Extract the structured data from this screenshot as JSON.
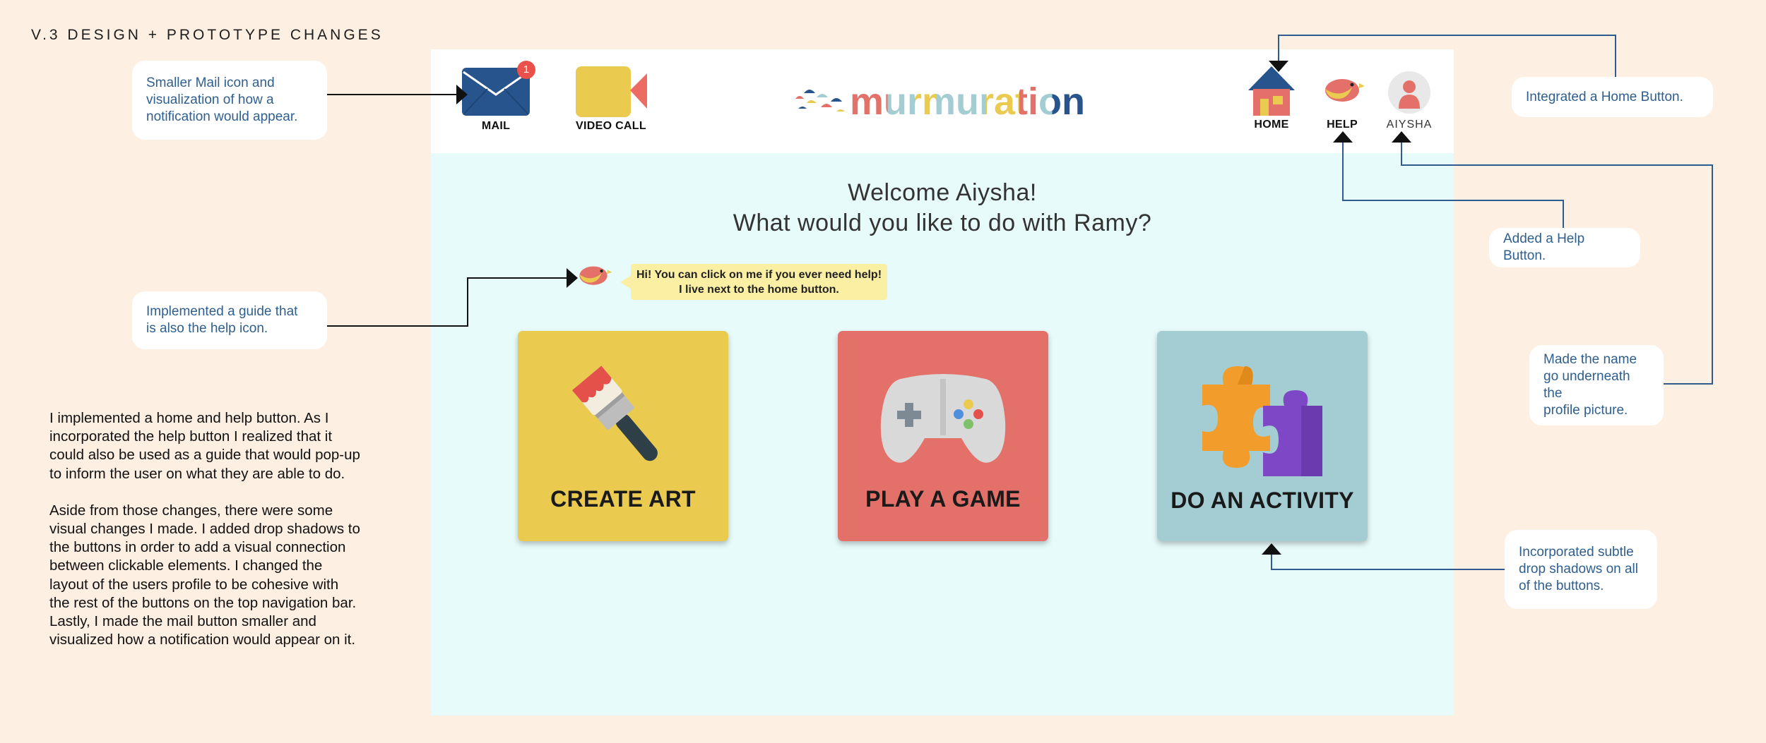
{
  "page_title": "V.3 DESIGN + PROTOTYPE CHANGES",
  "callouts": {
    "mail": "Smaller Mail icon and\nvisualization of how a\nnotification would appear.",
    "guide": "Implemented a guide that\nis also the help icon.",
    "home": "Integrated a Home Button.",
    "help": "Added a Help Button.",
    "name": "Made the name\ngo underneath the\nprofile picture.",
    "shadows": "Incorporated subtle\ndrop shadows on all\nof the buttons."
  },
  "summary": {
    "p1": "I implemented a home and help button. As I incorporated the help button I realized that it could also be used as a guide that would pop-up to inform the user on what they are able to do.",
    "p2": "Aside from those changes, there were some visual changes I made. I added drop shadows to the buttons in order to add a visual connection between clickable elements. I changed the layout of the users profile to be cohesive with the rest of the buttons on the top navigation bar. Lastly, I made the mail button smaller and visualized how a notification would appear on it."
  },
  "app": {
    "logo": "murmuration",
    "nav": {
      "mail": "MAIL",
      "mail_badge": "1",
      "video_call": "VIDEO CALL",
      "home": "HOME",
      "help": "HELP",
      "profile": "AIYSHA"
    },
    "welcome_line1": "Welcome Aiysha!",
    "welcome_line2": "What would you like to do with Ramy?",
    "guide_bubble": "Hi! You can click on me if you ever need help!\nI live next to the home button.",
    "cards": [
      {
        "label": "CREATE ART",
        "color": "#eacb50"
      },
      {
        "label": "PLAY A GAME",
        "color": "#e3716a"
      },
      {
        "label": "DO AN ACTIVITY",
        "color": "#a3cdd2"
      }
    ]
  },
  "colors": {
    "background": "#fdefe2",
    "app_bg": "#e8fbfb",
    "annotation_text": "#2e5f8f",
    "annotation_line": "#2f5b8e"
  },
  "icons": [
    "mail-icon",
    "video-call-icon",
    "home-icon",
    "bird-help-icon",
    "profile-icon",
    "paintbrush-icon",
    "gamepad-icon",
    "puzzle-icon"
  ]
}
